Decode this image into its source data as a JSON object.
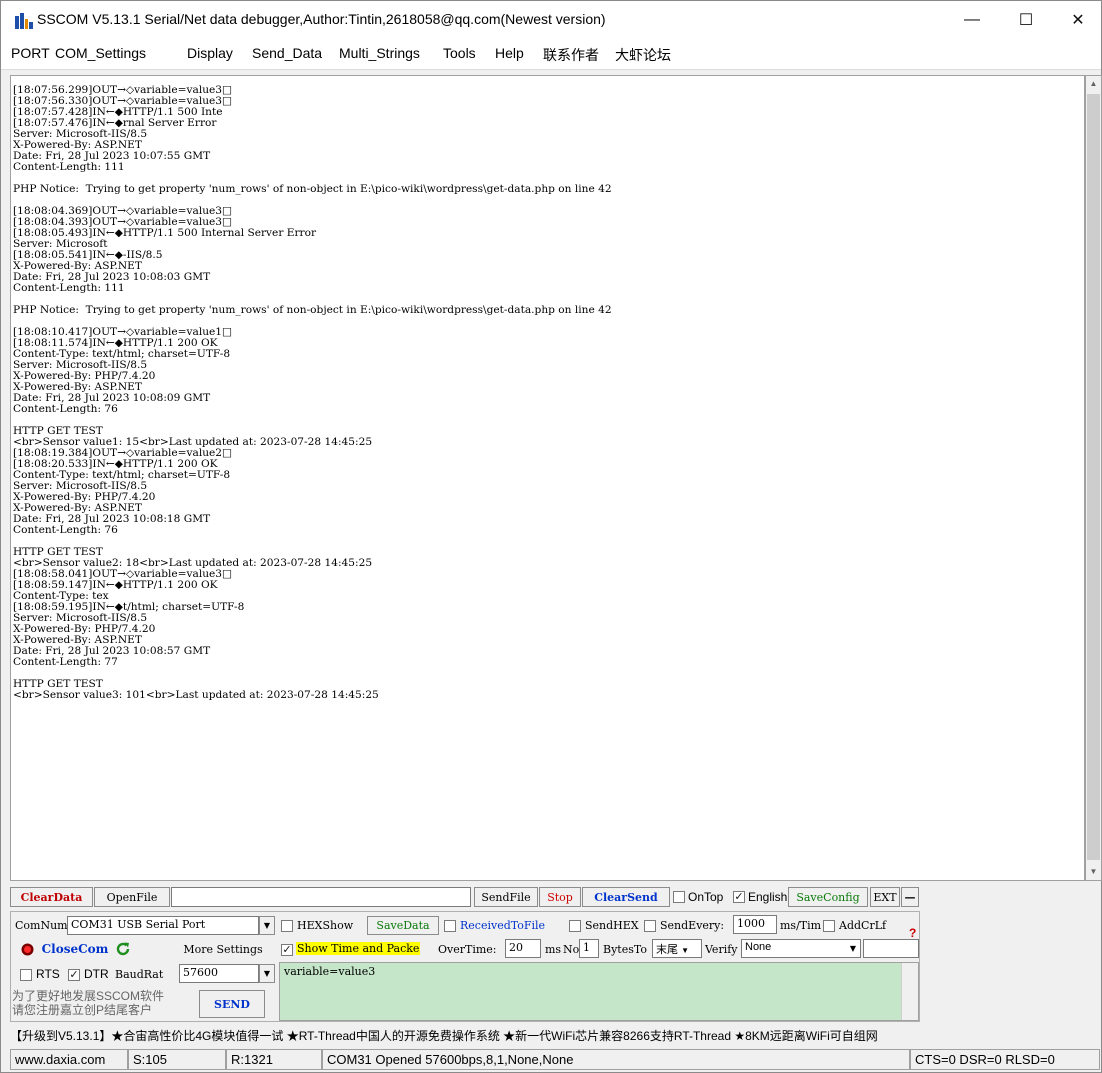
{
  "window": {
    "title": "SSCOM V5.13.1 Serial/Net data debugger,Author:Tintin,2618058@qq.com(Newest version)",
    "minimize": "—",
    "maximize": "☐",
    "close": "✕"
  },
  "menu": [
    "PORT",
    "COM_Settings",
    "Display",
    "Send_Data",
    "Multi_Strings",
    "Tools",
    "Help",
    "联系作者",
    "大虾论坛"
  ],
  "receive_log": "[18:07:56.299]OUT→◇variable=value3□\n[18:07:56.330]OUT→◇variable=value3□\n[18:07:57.428]IN←◆HTTP/1.1 500 Inte\n[18:07:57.476]IN←◆rnal Server Error\nServer: Microsoft-IIS/8.5\nX-Powered-By: ASP.NET\nDate: Fri, 28 Jul 2023 10:07:55 GMT\nContent-Length: 111\n\nPHP Notice:  Trying to get property 'num_rows' of non-object in E:\\pico-wiki\\wordpress\\get-data.php on line 42\n\n[18:08:04.369]OUT→◇variable=value3□\n[18:08:04.393]OUT→◇variable=value3□\n[18:08:05.493]IN←◆HTTP/1.1 500 Internal Server Error\nServer: Microsoft\n[18:08:05.541]IN←◆-IIS/8.5\nX-Powered-By: ASP.NET\nDate: Fri, 28 Jul 2023 10:08:03 GMT\nContent-Length: 111\n\nPHP Notice:  Trying to get property 'num_rows' of non-object in E:\\pico-wiki\\wordpress\\get-data.php on line 42\n\n[18:08:10.417]OUT→◇variable=value1□\n[18:08:11.574]IN←◆HTTP/1.1 200 OK\nContent-Type: text/html; charset=UTF-8\nServer: Microsoft-IIS/8.5\nX-Powered-By: PHP/7.4.20\nX-Powered-By: ASP.NET\nDate: Fri, 28 Jul 2023 10:08:09 GMT\nContent-Length: 76\n\nHTTP GET TEST\n<br>Sensor value1: 15<br>Last updated at: 2023-07-28 14:45:25\n[18:08:19.384]OUT→◇variable=value2□\n[18:08:20.533]IN←◆HTTP/1.1 200 OK\nContent-Type: text/html; charset=UTF-8\nServer: Microsoft-IIS/8.5\nX-Powered-By: PHP/7.4.20\nX-Powered-By: ASP.NET\nDate: Fri, 28 Jul 2023 10:08:18 GMT\nContent-Length: 76\n\nHTTP GET TEST\n<br>Sensor value2: 18<br>Last updated at: 2023-07-28 14:45:25\n[18:08:58.041]OUT→◇variable=value3□\n[18:08:59.147]IN←◆HTTP/1.1 200 OK\nContent-Type: tex\n[18:08:59.195]IN←◆t/html; charset=UTF-8\nServer: Microsoft-IIS/8.5\nX-Powered-By: PHP/7.4.20\nX-Powered-By: ASP.NET\nDate: Fri, 28 Jul 2023 10:08:57 GMT\nContent-Length: 77\n\nHTTP GET TEST\n<br>Sensor value3: 101<br>Last updated at: 2023-07-28 14:45:25",
  "toolbar": {
    "clear_data": "ClearData",
    "open_file": "OpenFile",
    "file_path": "",
    "send_file": "SendFile",
    "stop": "Stop",
    "clear_send": "ClearSend",
    "on_top": "OnTop",
    "english": "English",
    "save_config": "SaveConfig",
    "ext": "EXT",
    "collapse": "—"
  },
  "settings": {
    "com_num_label": "ComNum",
    "com_port": "COM31 USB Serial Port",
    "hex_show": "HEXShow",
    "save_data": "SaveData",
    "received_to_file": "ReceivedToFile",
    "send_hex": "SendHEX",
    "send_every": "SendEvery:",
    "send_every_value": "1000",
    "ms_tim": "ms/Tim",
    "add_crlf": "AddCrLf",
    "close_com": "CloseCom",
    "more_settings": "More Settings",
    "show_time": "Show Time and Packe",
    "over_time": "OverTime:",
    "over_time_value": "20",
    "ms": "ms",
    "no": "No",
    "no_value": "1",
    "bytes_to": "BytesTo",
    "tail": "末尾",
    "verify": "Verify",
    "verify_value": "None",
    "rts": "RTS",
    "dtr": "DTR",
    "baud_rate": "BaudRat",
    "baud_value": "57600",
    "send_text": "variable=value3",
    "promo_line1": "为了更好地发展SSCOM软件",
    "promo_line2": "请您注册嘉立创P结尾客户",
    "send": "SEND",
    "help_mark": "?"
  },
  "promo": "【升级到V5.13.1】★合宙高性价比4G模块值得一试 ★RT-Thread中国人的开源免费操作系统 ★新一代WiFi芯片兼容8266支持RT-Thread ★8KM远距离WiFi可自组网",
  "status": {
    "site": "www.daxia.com",
    "sent": "S:105",
    "received": "R:1321",
    "port_status": "COM31 Opened  57600bps,8,1,None,None",
    "lines": "CTS=0 DSR=0 RLSD=0"
  },
  "colors": {
    "send_box": "#c5e6c9",
    "show_time_highlight": "#ffff00",
    "clear_send": "#0033cc",
    "save_data": "#0a7a0a",
    "stop": "#cc0000"
  }
}
